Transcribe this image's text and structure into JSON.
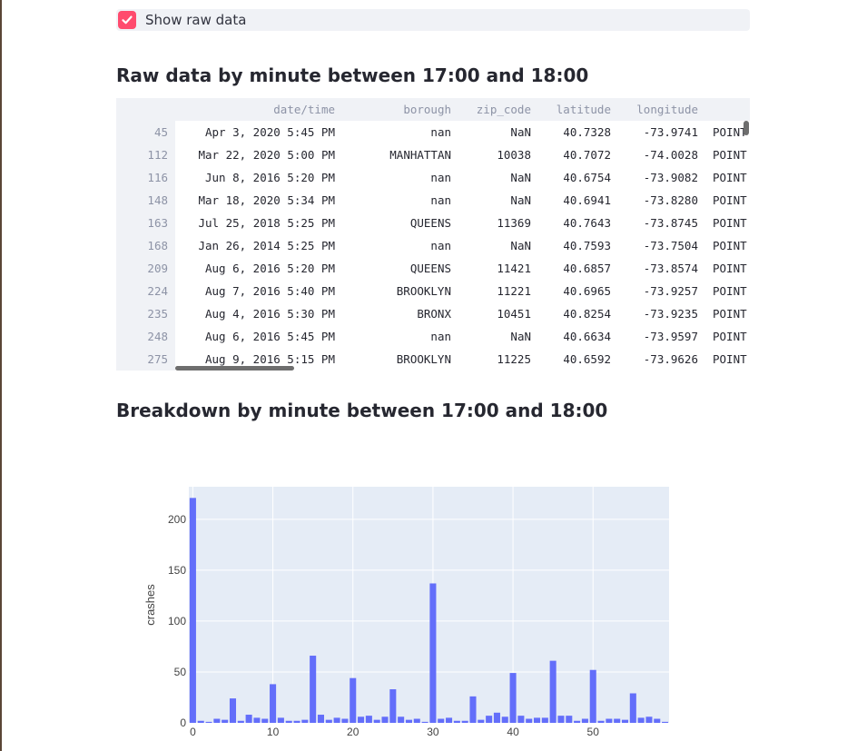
{
  "checkbox": {
    "label": "Show raw data",
    "checked": true,
    "accent": "#ff4b6e"
  },
  "raw_section": {
    "title": "Raw data by minute between 17:00 and 18:00"
  },
  "table": {
    "columns": [
      "date/time",
      "borough",
      "zip_code",
      "latitude",
      "longitude",
      "POINT"
    ],
    "rows": [
      {
        "index": "45",
        "datetime": "Apr 3, 2020 5:45 PM",
        "borough": "nan",
        "zip": "NaN",
        "lat": "40.7328",
        "lon": "-73.9741",
        "loc": "POINT"
      },
      {
        "index": "112",
        "datetime": "Mar 22, 2020 5:00 PM",
        "borough": "MANHATTAN",
        "zip": "10038",
        "lat": "40.7072",
        "lon": "-74.0028",
        "loc": "POINT"
      },
      {
        "index": "116",
        "datetime": "Jun 8, 2016 5:20 PM",
        "borough": "nan",
        "zip": "NaN",
        "lat": "40.6754",
        "lon": "-73.9082",
        "loc": "POINT"
      },
      {
        "index": "148",
        "datetime": "Mar 18, 2020 5:34 PM",
        "borough": "nan",
        "zip": "NaN",
        "lat": "40.6941",
        "lon": "-73.8280",
        "loc": "POINT"
      },
      {
        "index": "163",
        "datetime": "Jul 25, 2018 5:25 PM",
        "borough": "QUEENS",
        "zip": "11369",
        "lat": "40.7643",
        "lon": "-73.8745",
        "loc": "POINT"
      },
      {
        "index": "168",
        "datetime": "Jan 26, 2014 5:25 PM",
        "borough": "nan",
        "zip": "NaN",
        "lat": "40.7593",
        "lon": "-73.7504",
        "loc": "POINT"
      },
      {
        "index": "209",
        "datetime": "Aug 6, 2016 5:20 PM",
        "borough": "QUEENS",
        "zip": "11421",
        "lat": "40.6857",
        "lon": "-73.8574",
        "loc": "POINT"
      },
      {
        "index": "224",
        "datetime": "Aug 7, 2016 5:40 PM",
        "borough": "BROOKLYN",
        "zip": "11221",
        "lat": "40.6965",
        "lon": "-73.9257",
        "loc": "POINT"
      },
      {
        "index": "235",
        "datetime": "Aug 4, 2016 5:30 PM",
        "borough": "BRONX",
        "zip": "10451",
        "lat": "40.8254",
        "lon": "-73.9235",
        "loc": "POINT"
      },
      {
        "index": "248",
        "datetime": "Aug 6, 2016 5:45 PM",
        "borough": "nan",
        "zip": "NaN",
        "lat": "40.6634",
        "lon": "-73.9597",
        "loc": "POINT"
      },
      {
        "index": "275",
        "datetime": "Aug 9, 2016 5:15 PM",
        "borough": "BROOKLYN",
        "zip": "11225",
        "lat": "40.6592",
        "lon": "-73.9626",
        "loc": "POINT"
      }
    ]
  },
  "breakdown_section": {
    "title": "Breakdown by minute between 17:00 and 18:00"
  },
  "chart_data": {
    "type": "bar",
    "xlabel": "",
    "ylabel": "crashes",
    "xlim": [
      -0.5,
      59.5
    ],
    "ylim": [
      0,
      232
    ],
    "xticks": [
      0,
      10,
      20,
      30,
      40,
      50
    ],
    "yticks": [
      0,
      50,
      100,
      150,
      200
    ],
    "bar_color": "#636efa",
    "plot_bg": "#e5ecf6",
    "grid": true,
    "categories": [
      0,
      1,
      2,
      3,
      4,
      5,
      6,
      7,
      8,
      9,
      10,
      11,
      12,
      13,
      14,
      15,
      16,
      17,
      18,
      19,
      20,
      21,
      22,
      23,
      24,
      25,
      26,
      27,
      28,
      29,
      30,
      31,
      32,
      33,
      34,
      35,
      36,
      37,
      38,
      39,
      40,
      41,
      42,
      43,
      44,
      45,
      46,
      47,
      48,
      49,
      50,
      51,
      52,
      53,
      54,
      55,
      56,
      57,
      58,
      59
    ],
    "values": [
      221,
      2,
      1,
      4,
      3,
      24,
      2,
      8,
      5,
      4,
      38,
      5,
      2,
      2,
      3,
      66,
      8,
      3,
      5,
      4,
      44,
      6,
      7,
      3,
      6,
      33,
      6,
      3,
      4,
      1,
      137,
      4,
      5,
      2,
      2,
      26,
      3,
      7,
      10,
      6,
      49,
      7,
      4,
      5,
      5,
      61,
      7,
      7,
      2,
      4,
      52,
      2,
      4,
      4,
      3,
      29,
      5,
      6,
      4,
      1
    ]
  }
}
